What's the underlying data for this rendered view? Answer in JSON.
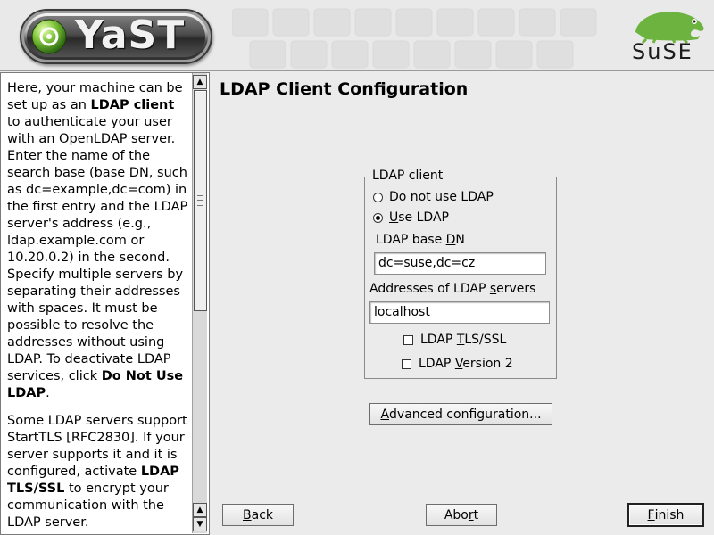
{
  "header": {
    "app_logo_text": "YaST",
    "vendor_logo_text": "SuSE"
  },
  "help": {
    "paragraphs": [
      [
        {
          "t": "Here, your machine can be set up as an "
        },
        {
          "t": "LDAP client",
          "b": true
        },
        {
          "t": " to authenticate your user with an OpenLDAP server. Enter the name of the search base (base DN, such as dc=example,dc=com) in the first entry and the LDAP server's address (e.g., ldap.example.com or 10.20.0.2) in the second. Specify multiple servers by separating their addresses with spaces. It must be possible to resolve the addresses without using LDAP. To deactivate LDAP services, click "
        },
        {
          "t": "Do Not Use LDAP",
          "b": true
        },
        {
          "t": "."
        }
      ],
      [
        {
          "t": "Some LDAP servers support StartTLS [RFC2830]. If your server supports it and it is configured, activate "
        },
        {
          "t": "LDAP TLS/SSL",
          "b": true
        },
        {
          "t": " to encrypt your communication with the LDAP server."
        }
      ]
    ]
  },
  "main": {
    "title": "LDAP Client Configuration",
    "group_label": "LDAP client",
    "radio_do_not_use": {
      "pre": "Do ",
      "key": "n",
      "post": "ot use LDAP",
      "checked": false
    },
    "radio_use": {
      "pre": "",
      "key": "U",
      "post": "se LDAP",
      "checked": true
    },
    "base_dn": {
      "pre": "LDAP base ",
      "key": "D",
      "post": "N",
      "value": "dc=suse,dc=cz"
    },
    "servers": {
      "pre": "Addresses of LDAP ",
      "key": "s",
      "post": "ervers",
      "value": "localhost"
    },
    "tls": {
      "pre": "LDAP ",
      "key": "T",
      "post": "LS/SSL",
      "checked": false
    },
    "version2": {
      "pre": "LDAP ",
      "key": "V",
      "post": "ersion 2",
      "checked": false
    },
    "advanced": {
      "pre": "",
      "key": "A",
      "post": "dvanced configuration..."
    }
  },
  "buttons": {
    "back": {
      "pre": "",
      "key": "B",
      "post": "ack"
    },
    "abort": {
      "pre": "Abo",
      "key": "r",
      "post": "t"
    },
    "finish": {
      "pre": "",
      "key": "F",
      "post": "inish"
    }
  },
  "colors": {
    "window_bg": "#ebebeb",
    "help_bg": "#ffffff",
    "suse_green": "#6db33f"
  },
  "icons": [
    "yast-logo-icon",
    "suse-chameleon-icon",
    "scroll-up-icon",
    "scroll-down-icon"
  ]
}
